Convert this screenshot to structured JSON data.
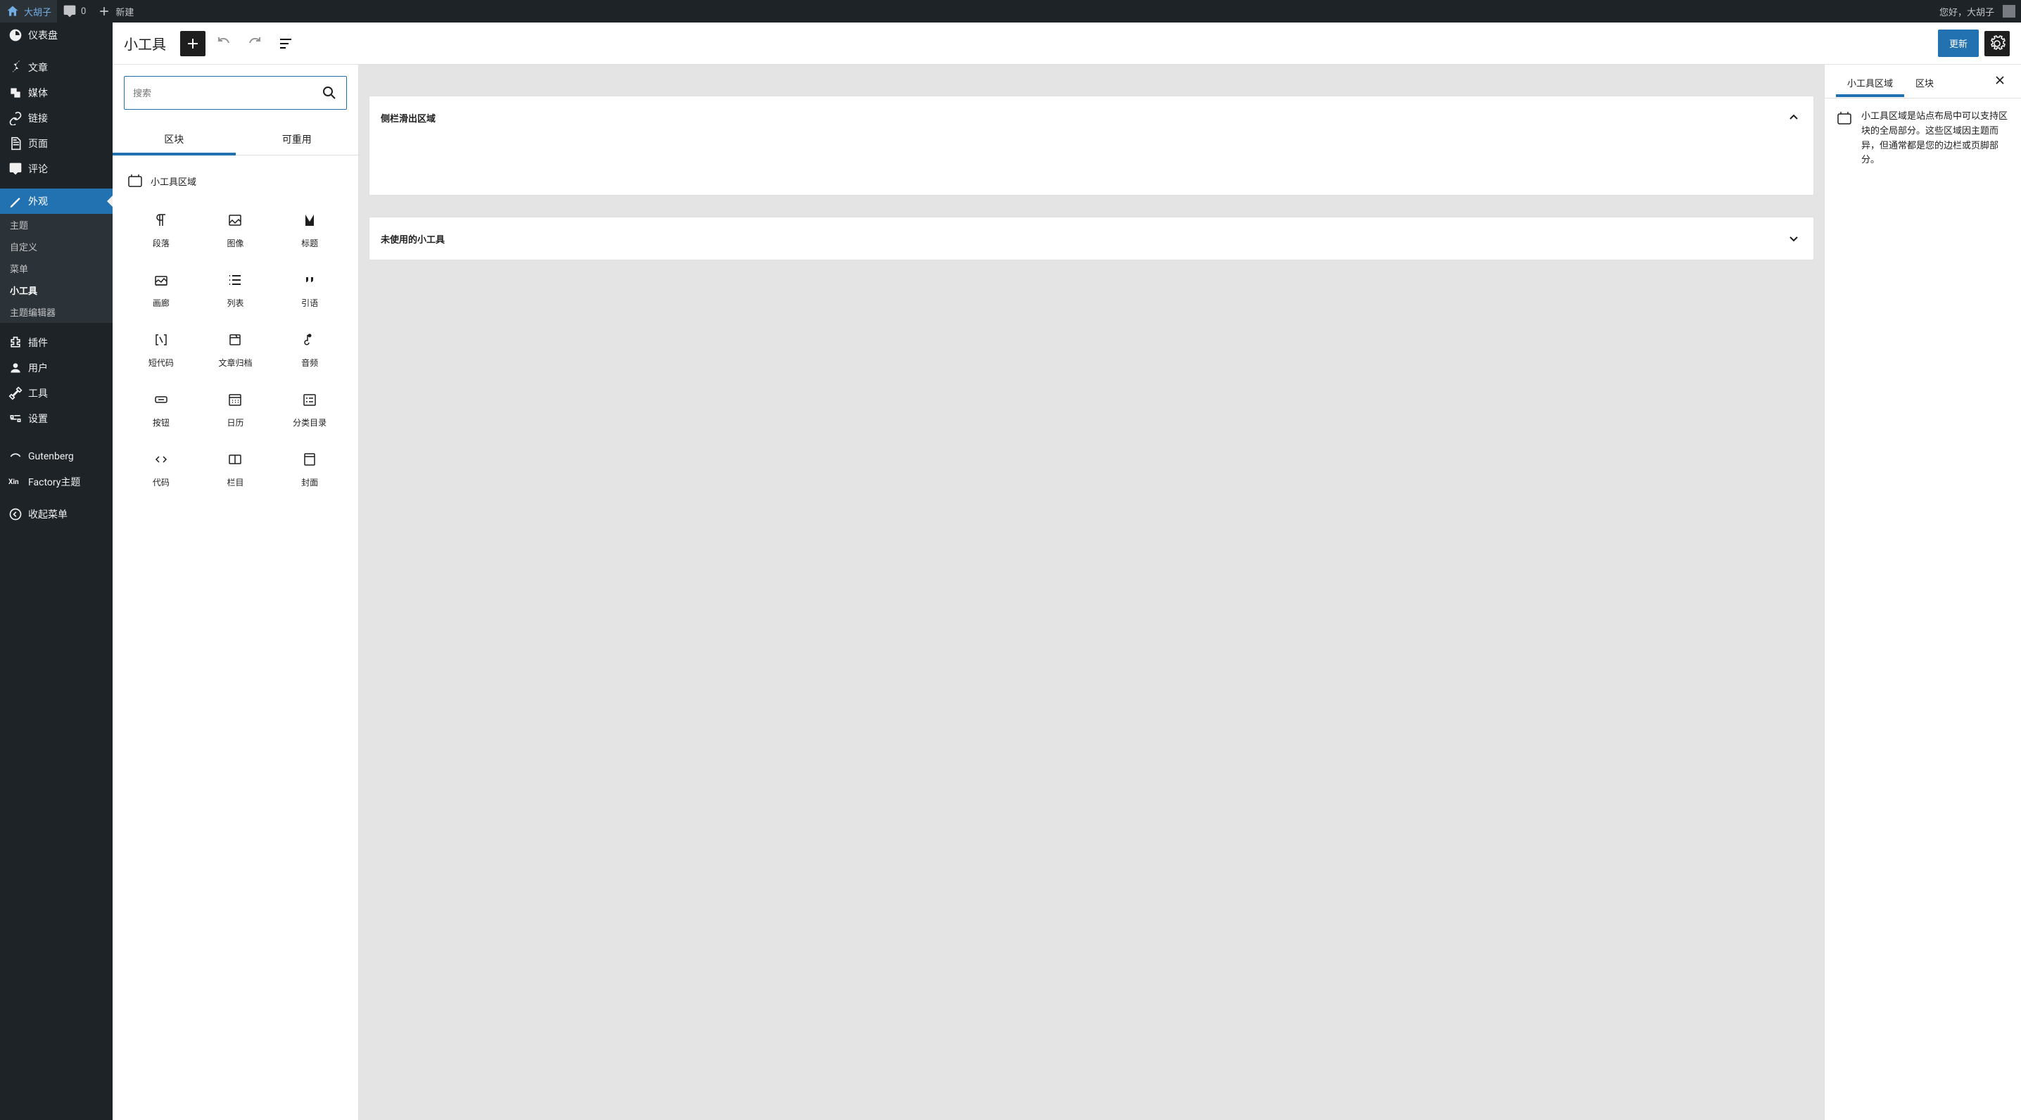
{
  "adminbar": {
    "site_name": "大胡子",
    "comments_count": "0",
    "new_label": "新建",
    "greeting": "您好，大胡子"
  },
  "sidebar": {
    "items": [
      {
        "label": "仪表盘",
        "icon": "dashboard"
      },
      {
        "label": "文章",
        "icon": "pin"
      },
      {
        "label": "媒体",
        "icon": "media"
      },
      {
        "label": "链接",
        "icon": "link"
      },
      {
        "label": "页面",
        "icon": "page"
      },
      {
        "label": "评论",
        "icon": "comment"
      },
      {
        "label": "外观",
        "icon": "appearance",
        "active": true
      },
      {
        "label": "插件",
        "icon": "plugin"
      },
      {
        "label": "用户",
        "icon": "user"
      },
      {
        "label": "工具",
        "icon": "tools"
      },
      {
        "label": "设置",
        "icon": "settings"
      },
      {
        "label": "Gutenberg",
        "icon": "gutenberg"
      },
      {
        "label": "Factory主题",
        "icon": "factory"
      },
      {
        "label": "收起菜单",
        "icon": "collapse"
      }
    ],
    "submenu": [
      {
        "label": "主题"
      },
      {
        "label": "自定义"
      },
      {
        "label": "菜单"
      },
      {
        "label": "小工具",
        "current": true
      },
      {
        "label": "主题编辑器"
      }
    ]
  },
  "header": {
    "title": "小工具",
    "update_button": "更新"
  },
  "inserter": {
    "search_placeholder": "搜索",
    "tabs": [
      "区块",
      "可重用"
    ],
    "section_title": "小工具区域",
    "blocks": [
      {
        "label": "段落",
        "icon": "paragraph"
      },
      {
        "label": "图像",
        "icon": "image"
      },
      {
        "label": "标题",
        "icon": "heading"
      },
      {
        "label": "画廊",
        "icon": "gallery"
      },
      {
        "label": "列表",
        "icon": "list"
      },
      {
        "label": "引语",
        "icon": "quote"
      },
      {
        "label": "短代码",
        "icon": "shortcode"
      },
      {
        "label": "文章归档",
        "icon": "archive"
      },
      {
        "label": "音频",
        "icon": "audio"
      },
      {
        "label": "按钮",
        "icon": "button"
      },
      {
        "label": "日历",
        "icon": "calendar"
      },
      {
        "label": "分类目录",
        "icon": "categories"
      },
      {
        "label": "代码",
        "icon": "code"
      },
      {
        "label": "栏目",
        "icon": "columns"
      },
      {
        "label": "封面",
        "icon": "cover"
      }
    ]
  },
  "canvas": {
    "areas": [
      {
        "title": "侧栏滑出区域",
        "expanded": true
      },
      {
        "title": "未使用的小工具",
        "expanded": false
      }
    ]
  },
  "settings_panel": {
    "tabs": [
      "小工具区域",
      "区块"
    ],
    "description": "小工具区域是站点布局中可以支持区块的全局部分。这些区域因主题而异，但通常都是您的边栏或页脚部分。"
  }
}
